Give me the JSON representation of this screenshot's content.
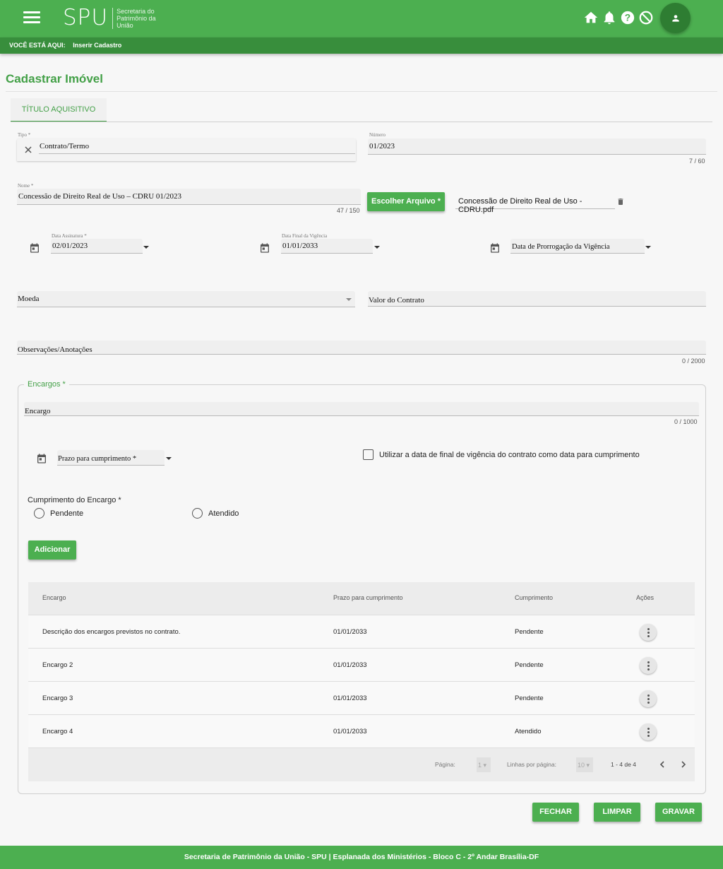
{
  "header": {
    "logo": "SPU",
    "logo_sub": "Secretaria do Patrimônio da União",
    "icons": [
      "menu-icon",
      "home-icon",
      "bell-icon",
      "help-icon",
      "block-icon",
      "person-icon"
    ]
  },
  "breadcrumb": {
    "label": "VOCÊ ESTÁ AQUI:",
    "current": "Inserir Cadastro"
  },
  "page_title": "Cadastrar Imóvel",
  "tabs": [
    {
      "label": "TÍTULO AQUISITIVO"
    }
  ],
  "form": {
    "tipo": {
      "label": "Tipo *",
      "value": "Contrato/Termo"
    },
    "numero": {
      "label": "Número",
      "value": "01/2023",
      "counter": "7 / 60"
    },
    "nome": {
      "label": "Nome *",
      "value": "Concessão de Direito Real de Uso – CDRU 01/2023",
      "counter": "47 / 150"
    },
    "arquivo": {
      "button": "Escolher Arquivo *",
      "file": "Concessão de Direito Real de Uso - CDRU.pdf"
    },
    "data_assinatura": {
      "label": "Data Assinatura *",
      "value": "02/01/2023"
    },
    "data_final": {
      "label": "Data Final da Vigência",
      "value": "01/01/2033"
    },
    "data_prorrogacao": {
      "placeholder": "Data de Prorrogação da Vigência"
    },
    "moeda": {
      "placeholder": "Moeda"
    },
    "valor": {
      "placeholder": "Valor do Contrato"
    },
    "observacoes": {
      "placeholder": "Observações/Anotações",
      "counter": "0 / 2000"
    }
  },
  "encargos": {
    "legend": "Encargos *",
    "encargo": {
      "placeholder": "Encargo",
      "counter": "0 / 1000"
    },
    "prazo": {
      "placeholder": "Prazo para cumprimento *"
    },
    "checkbox_label": "Utilizar a data de final de vigência do contrato como data para cumprimento",
    "cumprimento_label": "Cumprimento do Encargo *",
    "radio_options": [
      "Pendente",
      "Atendido"
    ],
    "add_button": "Adicionar",
    "table": {
      "headers": [
        "Encargo",
        "Prazo para cumprimento",
        "Cumprimento",
        "Ações"
      ],
      "rows": [
        [
          "Descrição dos encargos previstos no contrato.",
          "01/01/2033",
          "Pendente"
        ],
        [
          "Encargo 2",
          "01/01/2033",
          "Pendente"
        ],
        [
          "Encargo 3",
          "01/01/2033",
          "Pendente"
        ],
        [
          "Encargo 4",
          "01/01/2033",
          "Atendido"
        ]
      ],
      "pagination": {
        "page_label": "Página:",
        "page": "1",
        "rows_label": "Linhas por página:",
        "rows_per_page": "10",
        "range": "1 - 4 de 4"
      }
    }
  },
  "actions": {
    "fechar": "FECHAR",
    "limpar": "LIMPAR",
    "gravar": "GRAVAR"
  },
  "footer": "Secretaria de Patrimônio da União - SPU | Esplanada dos Ministérios - Bloco C - 2º Andar Brasília-DF",
  "colors": {
    "primary": "#4caf50",
    "primary_dark": "#388e3c",
    "accent_text": "#43a047"
  }
}
